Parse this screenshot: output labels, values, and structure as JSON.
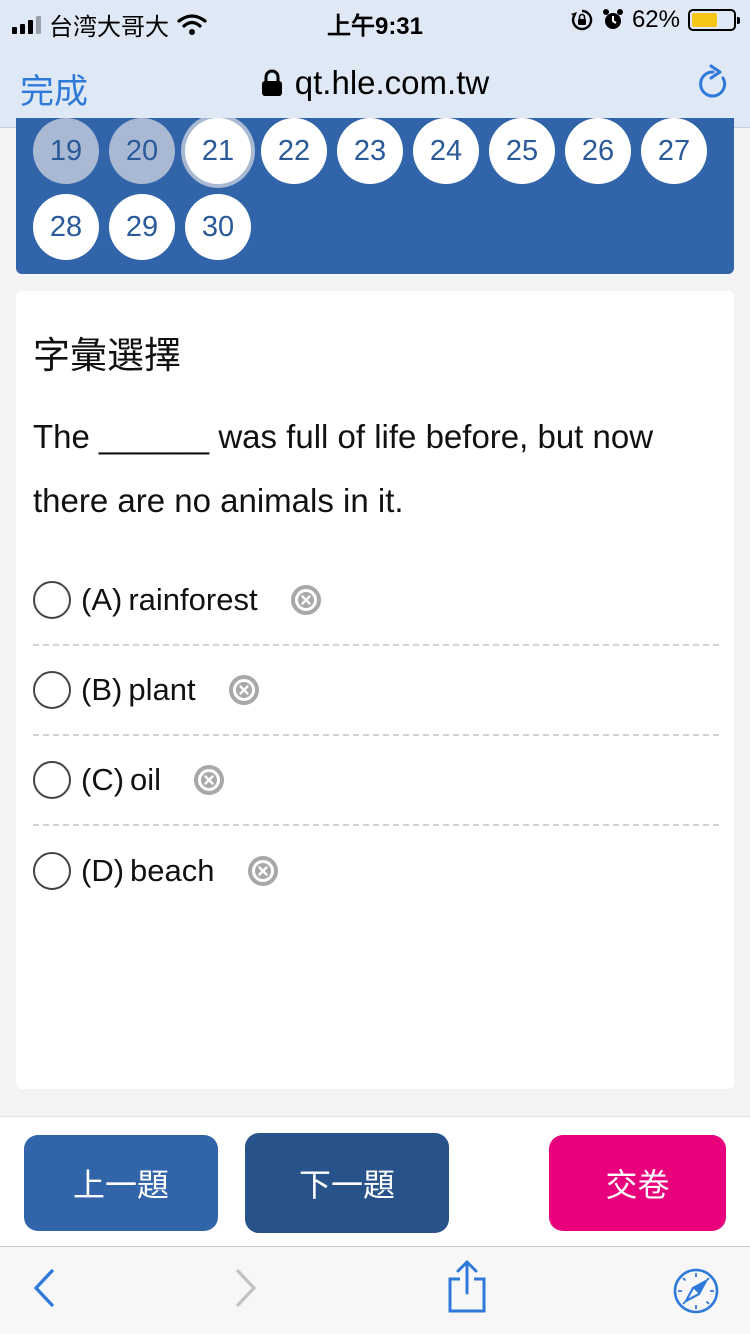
{
  "status_bar": {
    "carrier": "台湾大哥大",
    "time": "上午9:31",
    "battery_percent_label": "62%",
    "battery_level": 0.62
  },
  "browser": {
    "done_label": "完成",
    "url": "qt.hle.com.tw"
  },
  "question_grid": {
    "numbers": [
      "19",
      "20",
      "21",
      "22",
      "23",
      "24",
      "25",
      "26",
      "27",
      "28",
      "29",
      "30"
    ],
    "answered": [
      "19",
      "20"
    ],
    "current": "21"
  },
  "question": {
    "section_title": "字彙選擇",
    "text": "The ______ was full of life before, but now there are no animals in it.",
    "options": [
      {
        "letter": "(A)",
        "text": "rainforest"
      },
      {
        "letter": "(B)",
        "text": "plant"
      },
      {
        "letter": "(C)",
        "text": "oil"
      },
      {
        "letter": "(D)",
        "text": "beach"
      }
    ]
  },
  "actions": {
    "prev_label": "上一題",
    "next_label": "下一題",
    "submit_label": "交卷"
  },
  "colors": {
    "grid_blue": "#3164a8",
    "prev_button": "#3164a8",
    "next_button": "#27528a",
    "submit_button": "#e8007c",
    "ios_blue": "#2f7ad8"
  }
}
